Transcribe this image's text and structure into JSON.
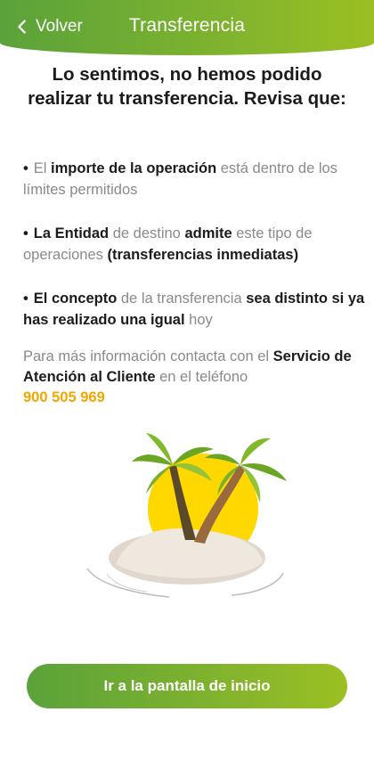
{
  "header": {
    "back_label": "Volver",
    "title": "Transferencia"
  },
  "heading": "Lo sentimos, no hemos podido realizar tu transferencia. Revisa que:",
  "bullets": [
    {
      "t1": "El ",
      "b1": "importe de la operación",
      "t2": " está dentro de los límites permitidos"
    },
    {
      "b1": "La Entidad",
      "t1": " de destino ",
      "b2": "admite",
      "t2": " este tipo de operaciones ",
      "b3": "(transferencias inmediatas)"
    },
    {
      "b1": "El concepto",
      "t1": " de la transferencia ",
      "b2": "sea distinto si ya has realizado una igual",
      "t2": " hoy"
    }
  ],
  "info": {
    "text1": "Para más información contacta con el ",
    "service": "Servicio de Atención al Cliente",
    "text2": " en el teléfono ",
    "phone": "900 505 969"
  },
  "cta_label": "Ir a la pantalla de inicio",
  "colors": {
    "brand_green": "#5aa23a",
    "lime": "#9cbf22",
    "phone": "#f0a800",
    "sun": "#ffd800"
  },
  "icons": {
    "back": "chevron-left-icon",
    "illustration": "palm-island-illustration"
  }
}
